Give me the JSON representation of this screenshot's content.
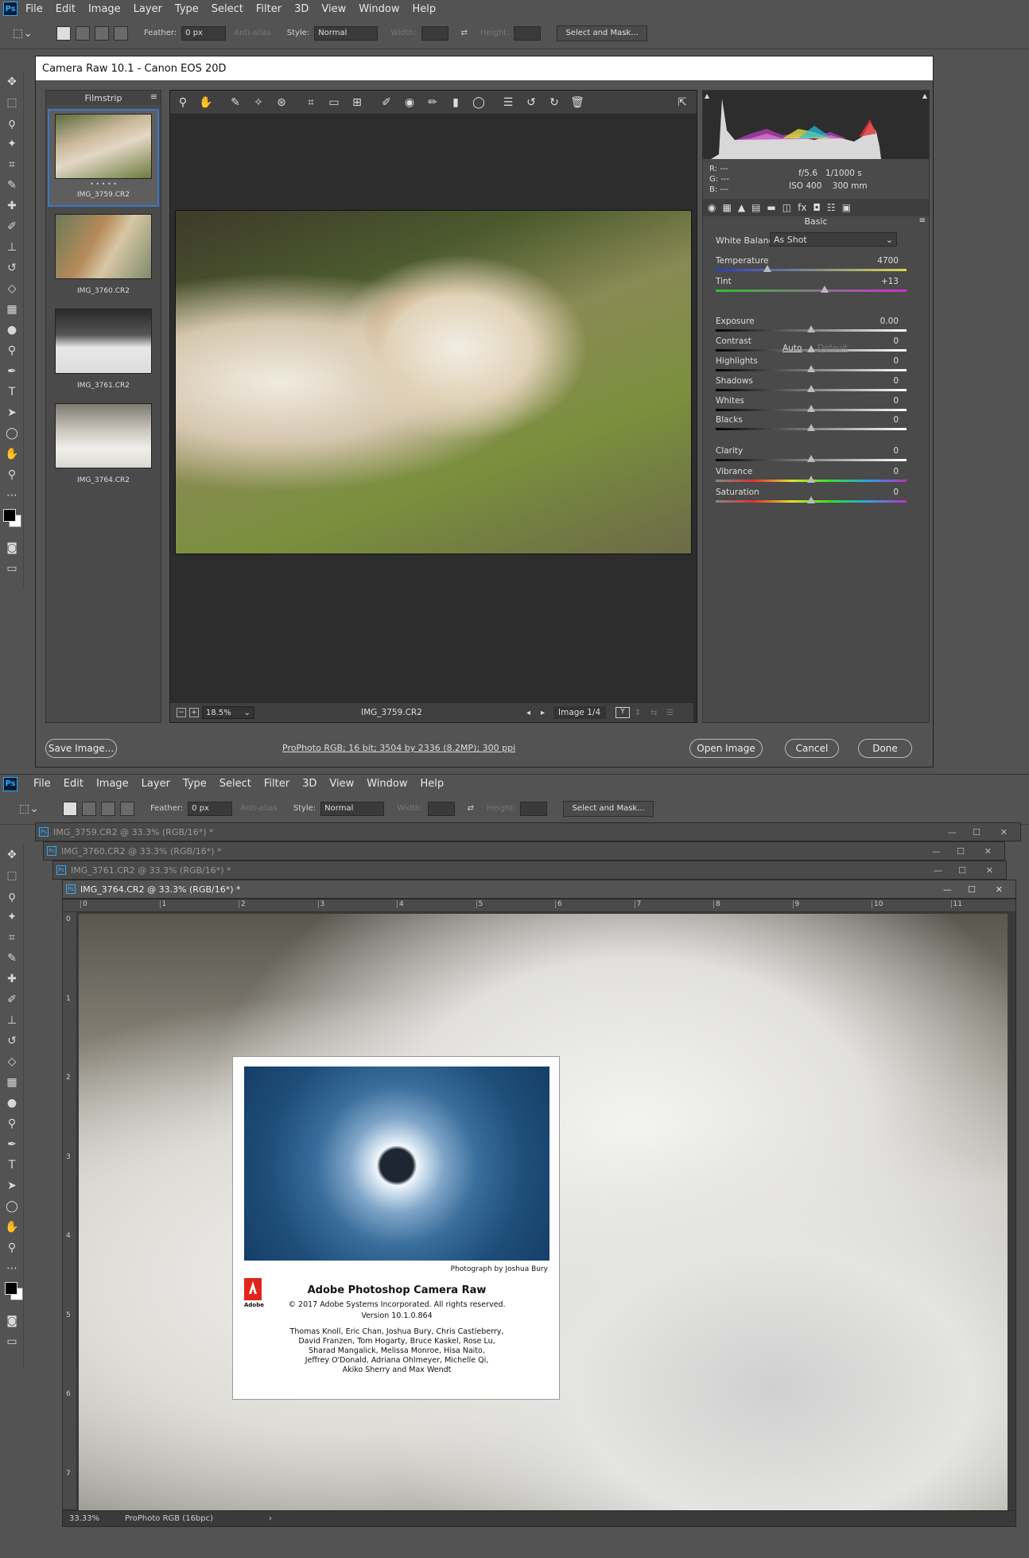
{
  "menu": [
    "File",
    "Edit",
    "Image",
    "Layer",
    "Type",
    "Select",
    "Filter",
    "3D",
    "View",
    "Window",
    "Help"
  ],
  "options": {
    "feather_label": "Feather:",
    "feather_value": "0 px",
    "antialias": "Anti-alias",
    "style_label": "Style:",
    "style_value": "Normal",
    "width_label": "Width:",
    "height_label": "Height:",
    "select_mask": "Select and Mask..."
  },
  "camera_raw": {
    "title": "Camera Raw 10.1  -  Canon EOS 20D",
    "filmstrip_label": "Filmstrip",
    "thumbs": [
      "IMG_3759.CR2",
      "IMG_3760.CR2",
      "IMG_3761.CR2",
      "IMG_3764.CR2"
    ],
    "zoom": "18.5%",
    "filename": "IMG_3759.CR2",
    "image_count": "Image 1/4",
    "rgb": {
      "r": "R:   ---",
      "g": "G:   ---",
      "b": "B:   ---"
    },
    "exif": {
      "aperture": "f/5.6",
      "shutter": "1/1000 s",
      "iso": "ISO 400",
      "focal": "300 mm"
    },
    "panel_title": "Basic",
    "wb_label": "White Balance:",
    "wb_value": "As Shot",
    "auto": "Auto",
    "default": "Default",
    "sliders": [
      {
        "label": "Temperature",
        "value": "4700",
        "pos": 0.27
      },
      {
        "label": "Tint",
        "value": "+13",
        "pos": 0.57
      },
      {
        "label": "Exposure",
        "value": "0.00",
        "pos": 0.5
      },
      {
        "label": "Contrast",
        "value": "0",
        "pos": 0.5
      },
      {
        "label": "Highlights",
        "value": "0",
        "pos": 0.5
      },
      {
        "label": "Shadows",
        "value": "0",
        "pos": 0.5
      },
      {
        "label": "Whites",
        "value": "0",
        "pos": 0.5
      },
      {
        "label": "Blacks",
        "value": "0",
        "pos": 0.5
      },
      {
        "label": "Clarity",
        "value": "0",
        "pos": 0.5
      },
      {
        "label": "Vibrance",
        "value": "0",
        "pos": 0.5
      },
      {
        "label": "Saturation",
        "value": "0",
        "pos": 0.5
      }
    ],
    "save_button": "Save Image...",
    "workflow": "ProPhoto RGB; 16 bit; 3504 by 2336 (8.2MP); 300 ppi",
    "open_button": "Open Image",
    "cancel_button": "Cancel",
    "done_button": "Done"
  },
  "docs": [
    "IMG_3759.CR2 @ 33.3% (RGB/16*) *",
    "IMG_3760.CR2 @ 33.3% (RGB/16*) *",
    "IMG_3761.CR2 @ 33.3% (RGB/16*) *",
    "IMG_3764.CR2 @ 33.3% (RGB/16*) *"
  ],
  "ruler_h": [
    "0",
    "1",
    "2",
    "3",
    "4",
    "5",
    "6",
    "7",
    "8",
    "9",
    "10",
    "11"
  ],
  "ruler_v": [
    "0",
    "1",
    "2",
    "3",
    "4",
    "5",
    "6",
    "7"
  ],
  "status": {
    "zoom": "33.33%",
    "profile": "ProPhoto RGB (16bpc)"
  },
  "about": {
    "credit": "Photograph by Joshua Bury",
    "title": "Adobe Photoshop Camera Raw",
    "copyright": "© 2017 Adobe Systems Incorporated. All rights reserved.",
    "version": "Version 10.1.0.864",
    "credits": [
      "Thomas Knoll, Eric Chan, Joshua Bury, Chris Castleberry,",
      "David Franzen, Tom Hogarty, Bruce Kaskel, Rose Lu,",
      "Sharad Mangalick, Melissa Monroe, Hisa Naito,",
      "Jeffrey O'Donald, Adriana Ohlmeyer, Michelle Qi,",
      "Akiko Sherry and Max Wendt"
    ],
    "logo_text": "Adobe"
  }
}
